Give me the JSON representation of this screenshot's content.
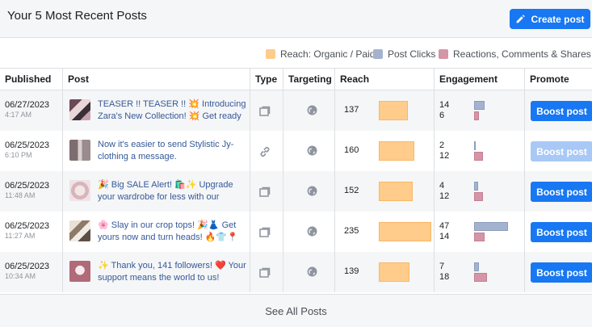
{
  "header": {
    "title": "Your 5 Most Recent Posts",
    "create_post_label": "Create post"
  },
  "legend": {
    "reach": {
      "label": "Reach: Organic / Paid",
      "color": "#ffcc8c"
    },
    "clicks": {
      "label": "Post Clicks",
      "color": "#a3b3cf"
    },
    "reactions": {
      "label": "Reactions, Comments & Shares",
      "color": "#d496a7"
    },
    "info_icon": "info-icon"
  },
  "columns": {
    "published": "Published",
    "post": "Post",
    "type": "Type",
    "targeting": "Targeting",
    "reach": "Reach",
    "engagement": "Engagement",
    "promote": "Promote"
  },
  "posts": [
    {
      "date": "06/27/2023",
      "time": "4:17 AM",
      "text": "TEASER !! TEASER !! 💥 Introducing Zara's New Collection! 💥 Get ready",
      "type": "album-icon",
      "targeting": "globe-icon",
      "reach": 137,
      "clicks": 14,
      "reactions": 6,
      "boost_label": "Boost post",
      "boost_enabled": true
    },
    {
      "date": "06/25/2023",
      "time": "6:10 PM",
      "text": "Now it's easier to send Stylistic Jy-clothing a message.",
      "type": "link-icon",
      "targeting": "globe-icon",
      "reach": 160,
      "clicks": 2,
      "reactions": 12,
      "boost_label": "Boost post",
      "boost_enabled": false
    },
    {
      "date": "06/25/2023",
      "time": "11:48 AM",
      "text": "🎉 Big SALE Alert! 🛍️✨ Upgrade your wardrobe for less with our",
      "type": "album-icon",
      "targeting": "globe-icon",
      "reach": 152,
      "clicks": 4,
      "reactions": 12,
      "boost_label": "Boost post",
      "boost_enabled": true
    },
    {
      "date": "06/25/2023",
      "time": "11:27 AM",
      "text": "🌸 Slay in our crop tops! 🎉👗 Get yours now and turn heads! 🔥👕📍",
      "type": "album-icon",
      "targeting": "globe-icon",
      "reach": 235,
      "clicks": 47,
      "reactions": 14,
      "boost_label": "Boost post",
      "boost_enabled": true
    },
    {
      "date": "06/25/2023",
      "time": "10:34 AM",
      "text": "✨ Thank you, 141 followers! ❤️ Your support means the world to us!",
      "type": "album-icon",
      "targeting": "globe-icon",
      "reach": 139,
      "clicks": 7,
      "reactions": 18,
      "boost_label": "Boost post",
      "boost_enabled": true
    }
  ],
  "footer": {
    "see_all_label": "See All Posts"
  }
}
